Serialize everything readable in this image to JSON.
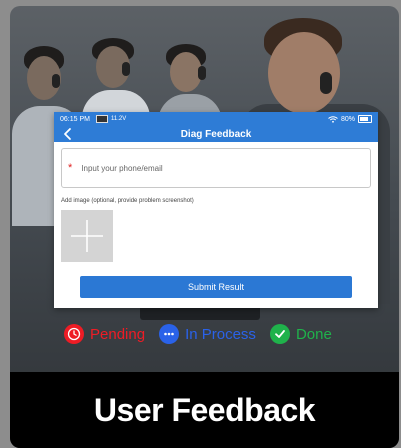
{
  "statusbar": {
    "time": "06:15 PM",
    "voltage": "11.2V",
    "battery": "80%"
  },
  "header": {
    "title": "Diag Feedback"
  },
  "form": {
    "required_mark": "*",
    "contact_placeholder": "Input your phone/email",
    "add_image_label": "Add image (optional, provide problem screenshot)",
    "submit_label": "Submit Result"
  },
  "legend": {
    "items": [
      {
        "label": "Pending",
        "color": "#ee1c25",
        "icon": "clock-icon"
      },
      {
        "label": "In Process",
        "color": "#2a62e9",
        "icon": "dots-icon"
      },
      {
        "label": "Done",
        "color": "#1fb24b",
        "icon": "check-icon"
      }
    ]
  },
  "footer": {
    "title": "User Feedback"
  },
  "colors": {
    "accent": "#2e7cd6",
    "button": "#2b78d4"
  }
}
